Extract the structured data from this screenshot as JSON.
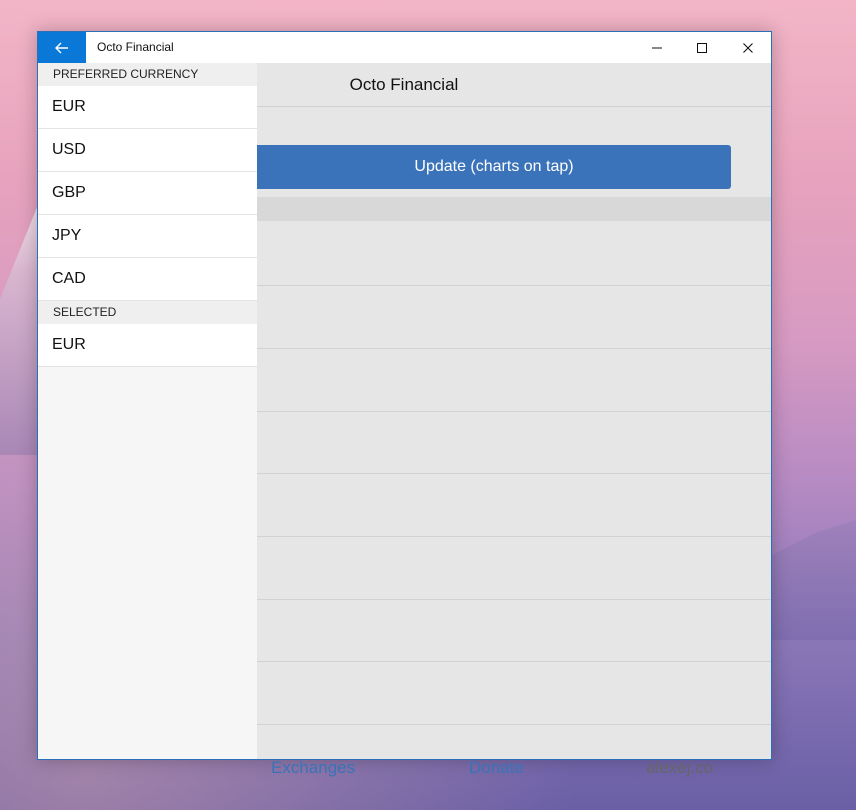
{
  "window": {
    "title": "Octo Financial"
  },
  "sidebar": {
    "preferred_header": "PREFERRED CURRENCY",
    "currencies": [
      "EUR",
      "USD",
      "GBP",
      "JPY",
      "CAD"
    ],
    "selected_header": "SELECTED",
    "selected": [
      "EUR"
    ]
  },
  "main": {
    "title": "Octo Financial",
    "update_button": "Update (charts on tap)"
  },
  "footer": {
    "exchanges": "Exchanges",
    "donate": "Donate",
    "site": "alexej.co"
  },
  "colors": {
    "accent": "#0a78d7",
    "button": "#3a73b9",
    "link": "#3a73b9",
    "muted_link": "#666666"
  },
  "icons": {
    "back": "back-arrow-icon",
    "minimize": "minimize-icon",
    "maximize": "maximize-icon",
    "close": "close-icon"
  }
}
